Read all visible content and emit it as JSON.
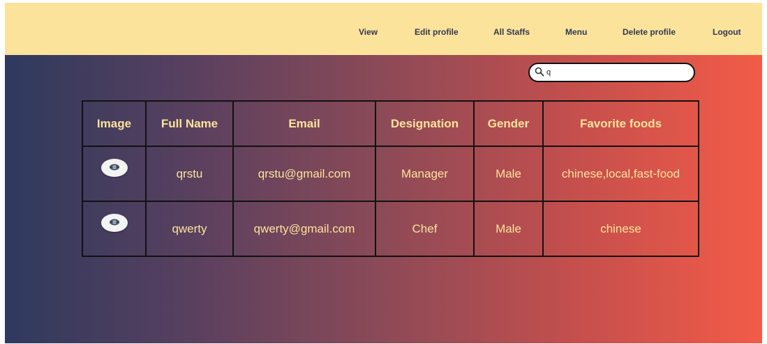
{
  "nav": {
    "items": [
      "View",
      "Edit profile",
      "All Staffs",
      "Menu",
      "Delete profile",
      "Logout"
    ]
  },
  "search": {
    "value": "q",
    "icon": "search-icon"
  },
  "table": {
    "headers": [
      "Image",
      "Full Name",
      "Email",
      "Designation",
      "Gender",
      "Favorite foods"
    ],
    "rows": [
      {
        "image": "avatar-icon",
        "full_name": "qrstu",
        "email": "qrstu@gmail.com",
        "designation": "Manager",
        "gender": "Male",
        "favorite_foods": "chinese,local,fast-food"
      },
      {
        "image": "avatar-icon",
        "full_name": "qwerty",
        "email": "qwerty@gmail.com",
        "designation": "Chef",
        "gender": "Male",
        "favorite_foods": "chinese"
      }
    ]
  },
  "colors": {
    "navbar_bg": "#fce39b",
    "nav_text": "#2f3850",
    "table_text": "#fce39b",
    "gradient_start": "#2e3a5e",
    "gradient_end": "#f35b47"
  }
}
